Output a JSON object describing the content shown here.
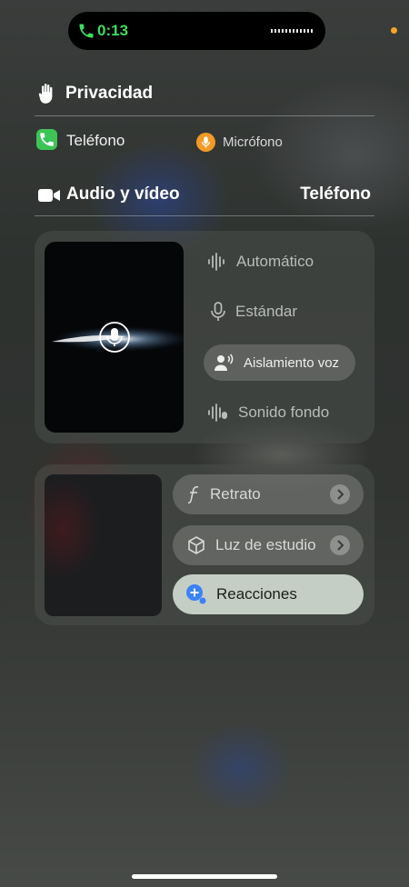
{
  "status": {
    "call_time": "0:13"
  },
  "privacy": {
    "title": "Privacidad",
    "app_name": "Teléfono",
    "mic_label": "Micrófono"
  },
  "audio_video": {
    "title": "Audio y vídeo",
    "app_name": "Teléfono"
  },
  "mic_modes": [
    {
      "label": "Automático",
      "icon": "waveform-icon",
      "selected": false
    },
    {
      "label": "Estándar",
      "icon": "microphone-icon",
      "selected": false
    },
    {
      "label": "Aislamiento voz",
      "icon": "person-voice-icon",
      "selected": true
    },
    {
      "label": "Sonido fondo",
      "icon": "waveform-ambient-icon",
      "selected": false
    }
  ],
  "video_effects": [
    {
      "label": "Retrato",
      "icon": "aperture-f-icon",
      "active": false
    },
    {
      "label": "Luz de estudio",
      "icon": "cube-icon",
      "active": false
    },
    {
      "label": "Reacciones",
      "icon": "reactions-plus-icon",
      "active": true
    }
  ],
  "colors": {
    "call_green": "#3ddc5e",
    "mic_orange": "#f29a28",
    "phone_app_green": "#3dc457"
  }
}
